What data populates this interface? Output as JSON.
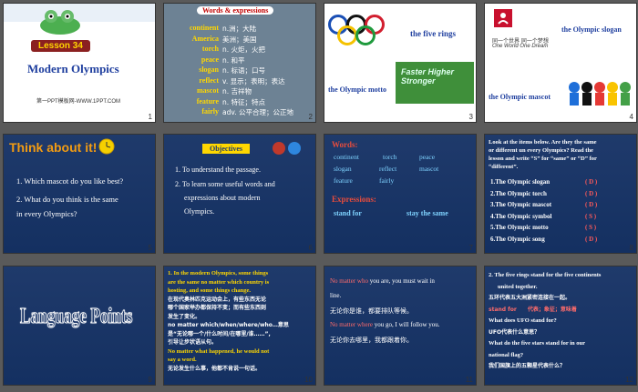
{
  "s1": {
    "lesson": "Lesson 34",
    "title": "Modern Olympics",
    "credit": "第一PPT模板网-WWW.1PPT.COM",
    "num": "1"
  },
  "s2": {
    "header": "Words & expressions",
    "num": "2",
    "words": [
      {
        "en": "continent",
        "zh": "n.洲；大陆"
      },
      {
        "en": "America",
        "zh": "美洲；美国"
      },
      {
        "en": "torch",
        "zh": "n. 火炬，火把"
      },
      {
        "en": "peace",
        "zh": "n. 和平"
      },
      {
        "en": "slogan",
        "zh": "n. 标语；口号"
      },
      {
        "en": "reflect",
        "zh": "v. 显示；表明；表达"
      },
      {
        "en": "mascot",
        "zh": "n. 吉祥物"
      },
      {
        "en": "feature",
        "zh": "n. 特征；特点"
      },
      {
        "en": "fairly",
        "zh": "adv. 公平合理；公正地"
      }
    ]
  },
  "s3": {
    "rings": "the five rings",
    "motto": "the Olympic motto",
    "motto_img": "Faster Higher Stronger",
    "num": "3"
  },
  "s4": {
    "slogan": "the Olympic slogan",
    "slogan_cn": "同一个世界 同一个梦想",
    "slogan_en": "One World One Dream",
    "mascot": "the Olympic mascot",
    "num": "4"
  },
  "s5": {
    "title": "Think about it!",
    "q1": "1. Which mascot do you like best?",
    "q2a": "2. What do you think is the same",
    "q2b": "in every Olympics?",
    "num": "5"
  },
  "s6": {
    "title": "Objectives",
    "o1": "1. To understand the passage.",
    "o2a": "2. To learn some useful words and",
    "o2b": "expressions about modern",
    "o2c": "Olympics.",
    "num": "6"
  },
  "s7": {
    "words_label": "Words:",
    "w1": "continent",
    "w2": "torch",
    "w3": "peace",
    "w4": "slogan",
    "w5": "reflect",
    "w6": "mascot",
    "w7": "feature",
    "w8": "fairly",
    "expr_label": "Expressions:",
    "e1": "stand for",
    "e2": "stay the same",
    "num": "7"
  },
  "s8": {
    "intro": [
      "Look at the items below. Are they the same",
      "or different un every Olympics? Read the",
      "lesson and write “S” for “same” or “D” for",
      "“different”."
    ],
    "items": [
      {
        "label": "1.The Olympic slogan",
        "ans": "( D )"
      },
      {
        "label": "2.The Olympic torch",
        "ans": "( D )"
      },
      {
        "label": "3.The Olympic mascot",
        "ans": "( D )"
      },
      {
        "label": "4.The Olympic symbol",
        "ans": "( S )"
      },
      {
        "label": "5.The Olympic motto",
        "ans": "( S )"
      },
      {
        "label": "6.The Olympic song",
        "ans": "( D )"
      }
    ],
    "num": "8"
  },
  "s9": {
    "title": "Language Points",
    "num": "9"
  },
  "s10": {
    "lines": [
      "1. In the modern Olympics, some things",
      "are the same no matter which country is",
      "hosting, and some things change.",
      "在现代奥林匹克运动会上，有些东西无论",
      "哪个国家举办都保持不变；而有些东西则",
      "发生了变化。",
      "no matter which/when/where/who…意思",
      "是“无论哪一个/什么时间/在哪里/谁……”,",
      "引导让步状语从句。",
      "No matter what happened, he would not",
      "say a word.",
      "无论发生什么事，他都不肯说一句话。"
    ],
    "num": "10"
  },
  "s11": {
    "l1": "No matter who you are, you must wait in",
    "l2": "line.",
    "l3": "无论你是谁，都要排队等候。",
    "l4": "No matter where you go, I will follow you.",
    "l5": "无论你去哪里，我都跟着你。",
    "num": "11"
  },
  "s12": {
    "l1": "2. The five rings stand for the five continents",
    "l2": "united together.",
    "l3": "五环代表五大洲紧密连接在一起。",
    "l4": "stand for　　代表；象征；意味着",
    "l5": "What does UFO stand for?",
    "l6": "UFO代表什么意思？",
    "l7": "What do the five stars stand for in our",
    "l8": "national flag?",
    "l9": "我们国旗上的五颗星代表什么？",
    "num": "12"
  }
}
